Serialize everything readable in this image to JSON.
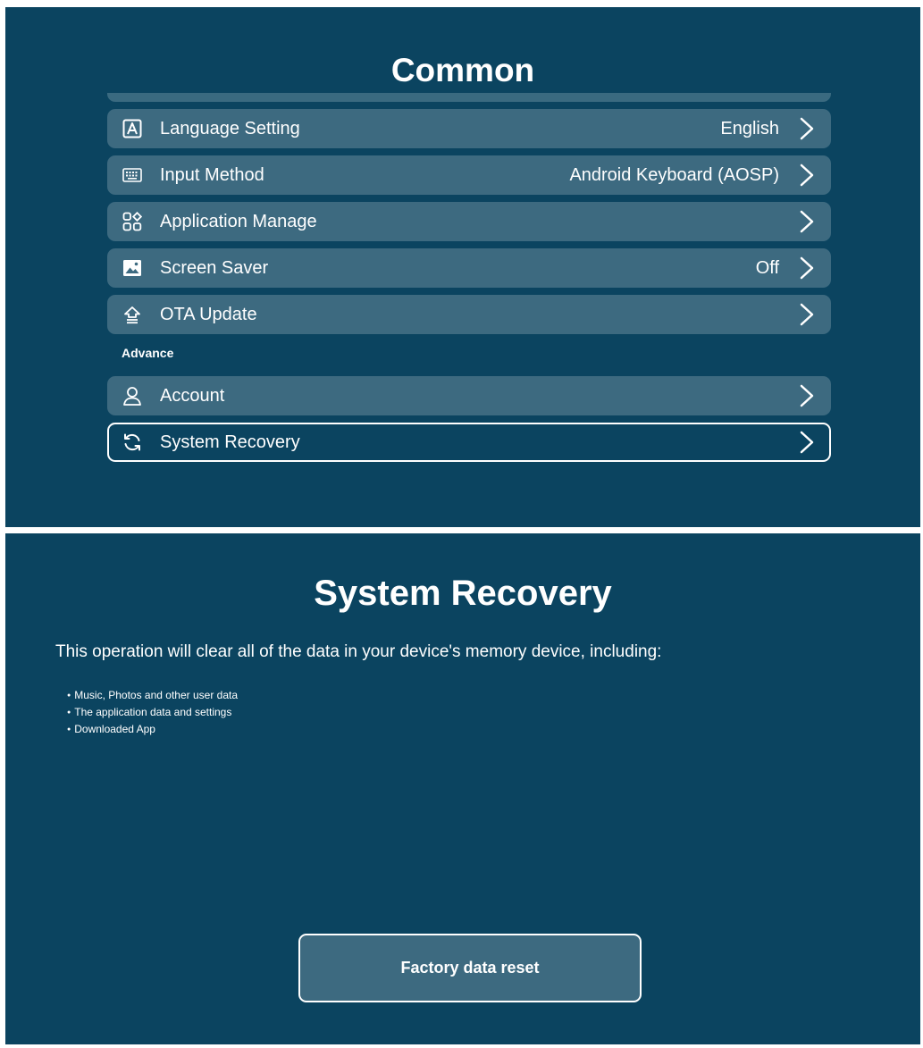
{
  "common": {
    "title": "Common",
    "section_advance": "Advance",
    "items": [
      {
        "label": "Language Setting",
        "value": "English",
        "icon": "language-icon"
      },
      {
        "label": "Input Method",
        "value": "Android Keyboard (AOSP)",
        "icon": "keyboard-icon"
      },
      {
        "label": "Application Manage",
        "value": "",
        "icon": "apps-icon"
      },
      {
        "label": "Screen Saver",
        "value": "Off",
        "icon": "image-icon"
      },
      {
        "label": "OTA Update",
        "value": "",
        "icon": "upload-icon"
      }
    ],
    "advance_items": [
      {
        "label": "Account",
        "value": "",
        "icon": "user-icon"
      },
      {
        "label": "System Recovery",
        "value": "",
        "icon": "recovery-icon",
        "focused": true
      }
    ]
  },
  "recovery": {
    "title": "System Recovery",
    "intro": "This operation will clear all of the data in your device's memory device, including:",
    "bullets": [
      "Music, Photos and other user data",
      "The application data and settings",
      "Downloaded App"
    ],
    "button_label": "Factory data reset"
  },
  "colors": {
    "background": "#0b4460",
    "row": "#3d6a80",
    "focus_border": "#ffffff"
  }
}
